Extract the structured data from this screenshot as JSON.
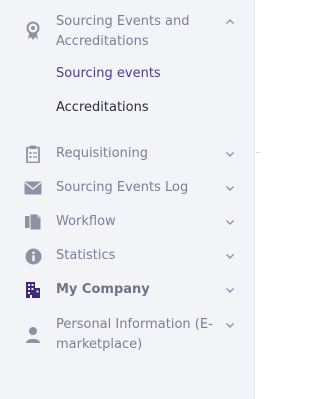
{
  "colors": {
    "sidebar_bg": "#f3f4f8",
    "label": "#7b7f94",
    "icon": "#8e92a4",
    "active_sub": "#4a3a8a",
    "company_icon": "#3f2a7a"
  },
  "nav": {
    "sourcing_events_accreditations": {
      "label": "Sourcing Events and Accreditations",
      "icon": "award-badge-icon",
      "expanded": true,
      "children": [
        {
          "label": "Sourcing events"
        },
        {
          "label": "Accreditations"
        }
      ]
    },
    "requisitioning": {
      "label": "Requisitioning",
      "icon": "clipboard-icon"
    },
    "sourcing_events_log": {
      "label": "Sourcing Events Log",
      "icon": "envelope-icon"
    },
    "workflow": {
      "label": "Workflow",
      "icon": "documents-icon"
    },
    "statistics": {
      "label": "Statistics",
      "icon": "info-icon"
    },
    "my_company": {
      "label": "My Company",
      "icon": "building-icon"
    },
    "personal_information": {
      "label": "Personal Information (E-marketplace)",
      "icon": "person-icon"
    }
  }
}
